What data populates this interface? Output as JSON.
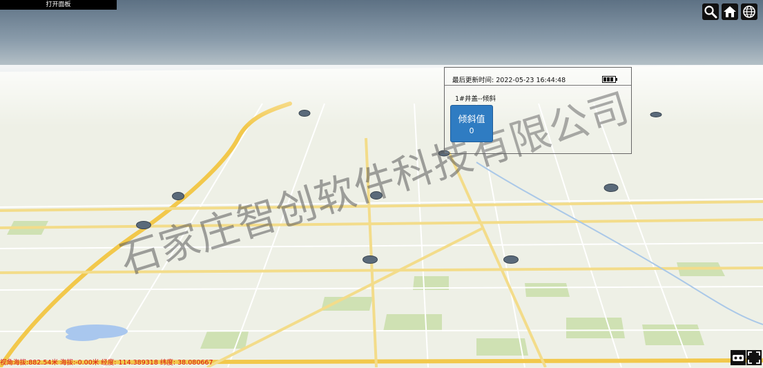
{
  "toolbar": {
    "open_panel_label": "打开面板",
    "search_icon": "search-icon",
    "home_icon": "home-icon",
    "globe_icon": "globe-icon"
  },
  "popup": {
    "time_label": "最后更新时间:",
    "time_value": "2022-05-23 16:44:48",
    "device_name": "1#井盖--倾斜",
    "metric_label": "倾斜值",
    "metric_value": "0",
    "battery_icon": "battery-full-icon"
  },
  "watermark": "石家庄智创软件科技有限公司",
  "status": "视角海拔:882.54米 海拔:-0.00米 经度: 114.389318 纬度: 38.080667",
  "map_controls": {
    "vr_icon": "vr-glasses-icon",
    "fullscreen_icon": "fullscreen-icon"
  },
  "colors": {
    "accent": "#2f7cc2",
    "status_text": "#d81010",
    "road_major": "#f2c84b",
    "road_minor": "#f3dc8a",
    "marker": "#5a6a7a"
  }
}
